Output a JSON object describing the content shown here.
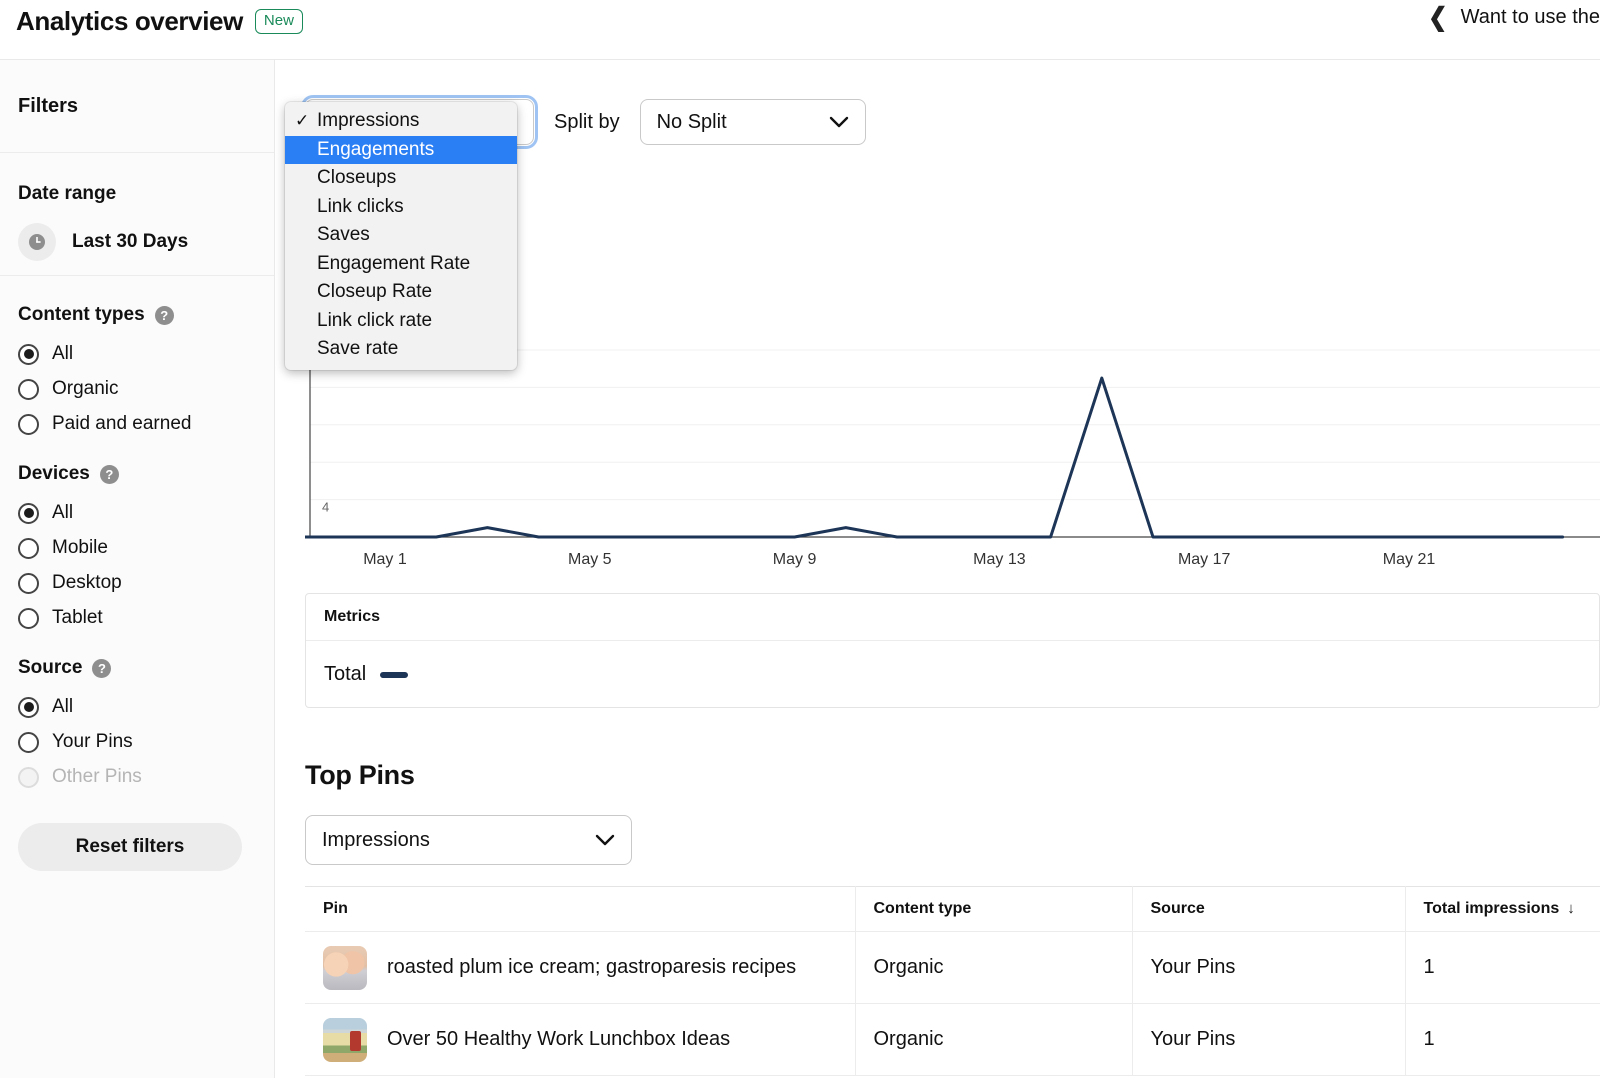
{
  "header": {
    "title": "Analytics overview",
    "badge": "New",
    "back_icon": "chevron-left-icon",
    "right_text": "Want to use the"
  },
  "sidebar": {
    "filters_label": "Filters",
    "date_range": {
      "heading": "Date range",
      "icon": "clock-icon",
      "value": "Last 30 Days"
    },
    "content_types": {
      "heading": "Content types",
      "help_icon": "?",
      "options": [
        {
          "label": "All",
          "selected": true,
          "disabled": false
        },
        {
          "label": "Organic",
          "selected": false,
          "disabled": false
        },
        {
          "label": "Paid and earned",
          "selected": false,
          "disabled": false
        }
      ]
    },
    "devices": {
      "heading": "Devices",
      "help_icon": "?",
      "options": [
        {
          "label": "All",
          "selected": true,
          "disabled": false
        },
        {
          "label": "Mobile",
          "selected": false,
          "disabled": false
        },
        {
          "label": "Desktop",
          "selected": false,
          "disabled": false
        },
        {
          "label": "Tablet",
          "selected": false,
          "disabled": false
        }
      ]
    },
    "source": {
      "heading": "Source",
      "help_icon": "?",
      "options": [
        {
          "label": "All",
          "selected": true,
          "disabled": false
        },
        {
          "label": "Your Pins",
          "selected": false,
          "disabled": false
        },
        {
          "label": "Other Pins",
          "selected": false,
          "disabled": true
        }
      ]
    },
    "reset_label": "Reset filters"
  },
  "controls": {
    "metric_value": "Impressions",
    "split_by_label": "Split by",
    "split_value": "No Split",
    "caret_icon": "chevron-down-icon"
  },
  "dropdown": {
    "check_icon": "✓",
    "items": [
      {
        "label": "Impressions",
        "checked": true,
        "highlighted": false
      },
      {
        "label": "Engagements",
        "checked": false,
        "highlighted": true
      },
      {
        "label": "Closeups",
        "checked": false,
        "highlighted": false
      },
      {
        "label": "Link clicks",
        "checked": false,
        "highlighted": false
      },
      {
        "label": "Saves",
        "checked": false,
        "highlighted": false
      },
      {
        "label": "Engagement Rate",
        "checked": false,
        "highlighted": false
      },
      {
        "label": "Closeup Rate",
        "checked": false,
        "highlighted": false
      },
      {
        "label": "Link click rate",
        "checked": false,
        "highlighted": false
      },
      {
        "label": "Save rate",
        "checked": false,
        "highlighted": false
      }
    ]
  },
  "metrics_legend": {
    "header": "Metrics",
    "series_name": "Total",
    "series_color": "#1d3557"
  },
  "top_pins": {
    "title": "Top Pins",
    "metric_value": "Impressions",
    "columns": [
      "Pin",
      "Content type",
      "Source",
      "Total impressions"
    ],
    "sort_icon": "↓",
    "rows": [
      {
        "thumb": "pin-thumbnail-ice-cream",
        "pin": "roasted plum ice cream; gastroparesis recipes",
        "content_type": "Organic",
        "source": "Your Pins",
        "total_impressions": "1"
      },
      {
        "thumb": "pin-thumbnail-lunchbox",
        "pin": "Over 50 Healthy Work Lunchbox Ideas",
        "content_type": "Organic",
        "source": "Your Pins",
        "total_impressions": "1"
      }
    ]
  },
  "chart_data": {
    "type": "line",
    "title": "",
    "xlabel": "",
    "ylabel": "",
    "line_color": "#1d3557",
    "grid": true,
    "legend_position": "below-chart",
    "ylim": [
      0,
      20
    ],
    "yticks": [
      4
    ],
    "ytick_labels": [
      "4"
    ],
    "xticks": [
      "May 1",
      "May 5",
      "May 9",
      "May 13",
      "May 17",
      "May 21"
    ],
    "x": [
      "Apr 29",
      "Apr 30",
      "May 1",
      "May 2",
      "May 3",
      "May 4",
      "May 5",
      "May 6",
      "May 7",
      "May 8",
      "May 9",
      "May 10",
      "May 11",
      "May 12",
      "May 13",
      "May 14",
      "May 15",
      "May 16",
      "May 17",
      "May 18",
      "May 19",
      "May 20",
      "May 21",
      "May 22",
      "May 23",
      "May 24"
    ],
    "series": [
      {
        "name": "Total",
        "values": [
          0,
          0,
          0,
          0,
          1,
          0,
          0,
          0,
          0,
          0,
          0,
          1,
          0,
          0,
          0,
          0,
          17,
          0,
          0,
          0,
          0,
          0,
          0,
          0,
          0,
          0
        ]
      }
    ]
  }
}
